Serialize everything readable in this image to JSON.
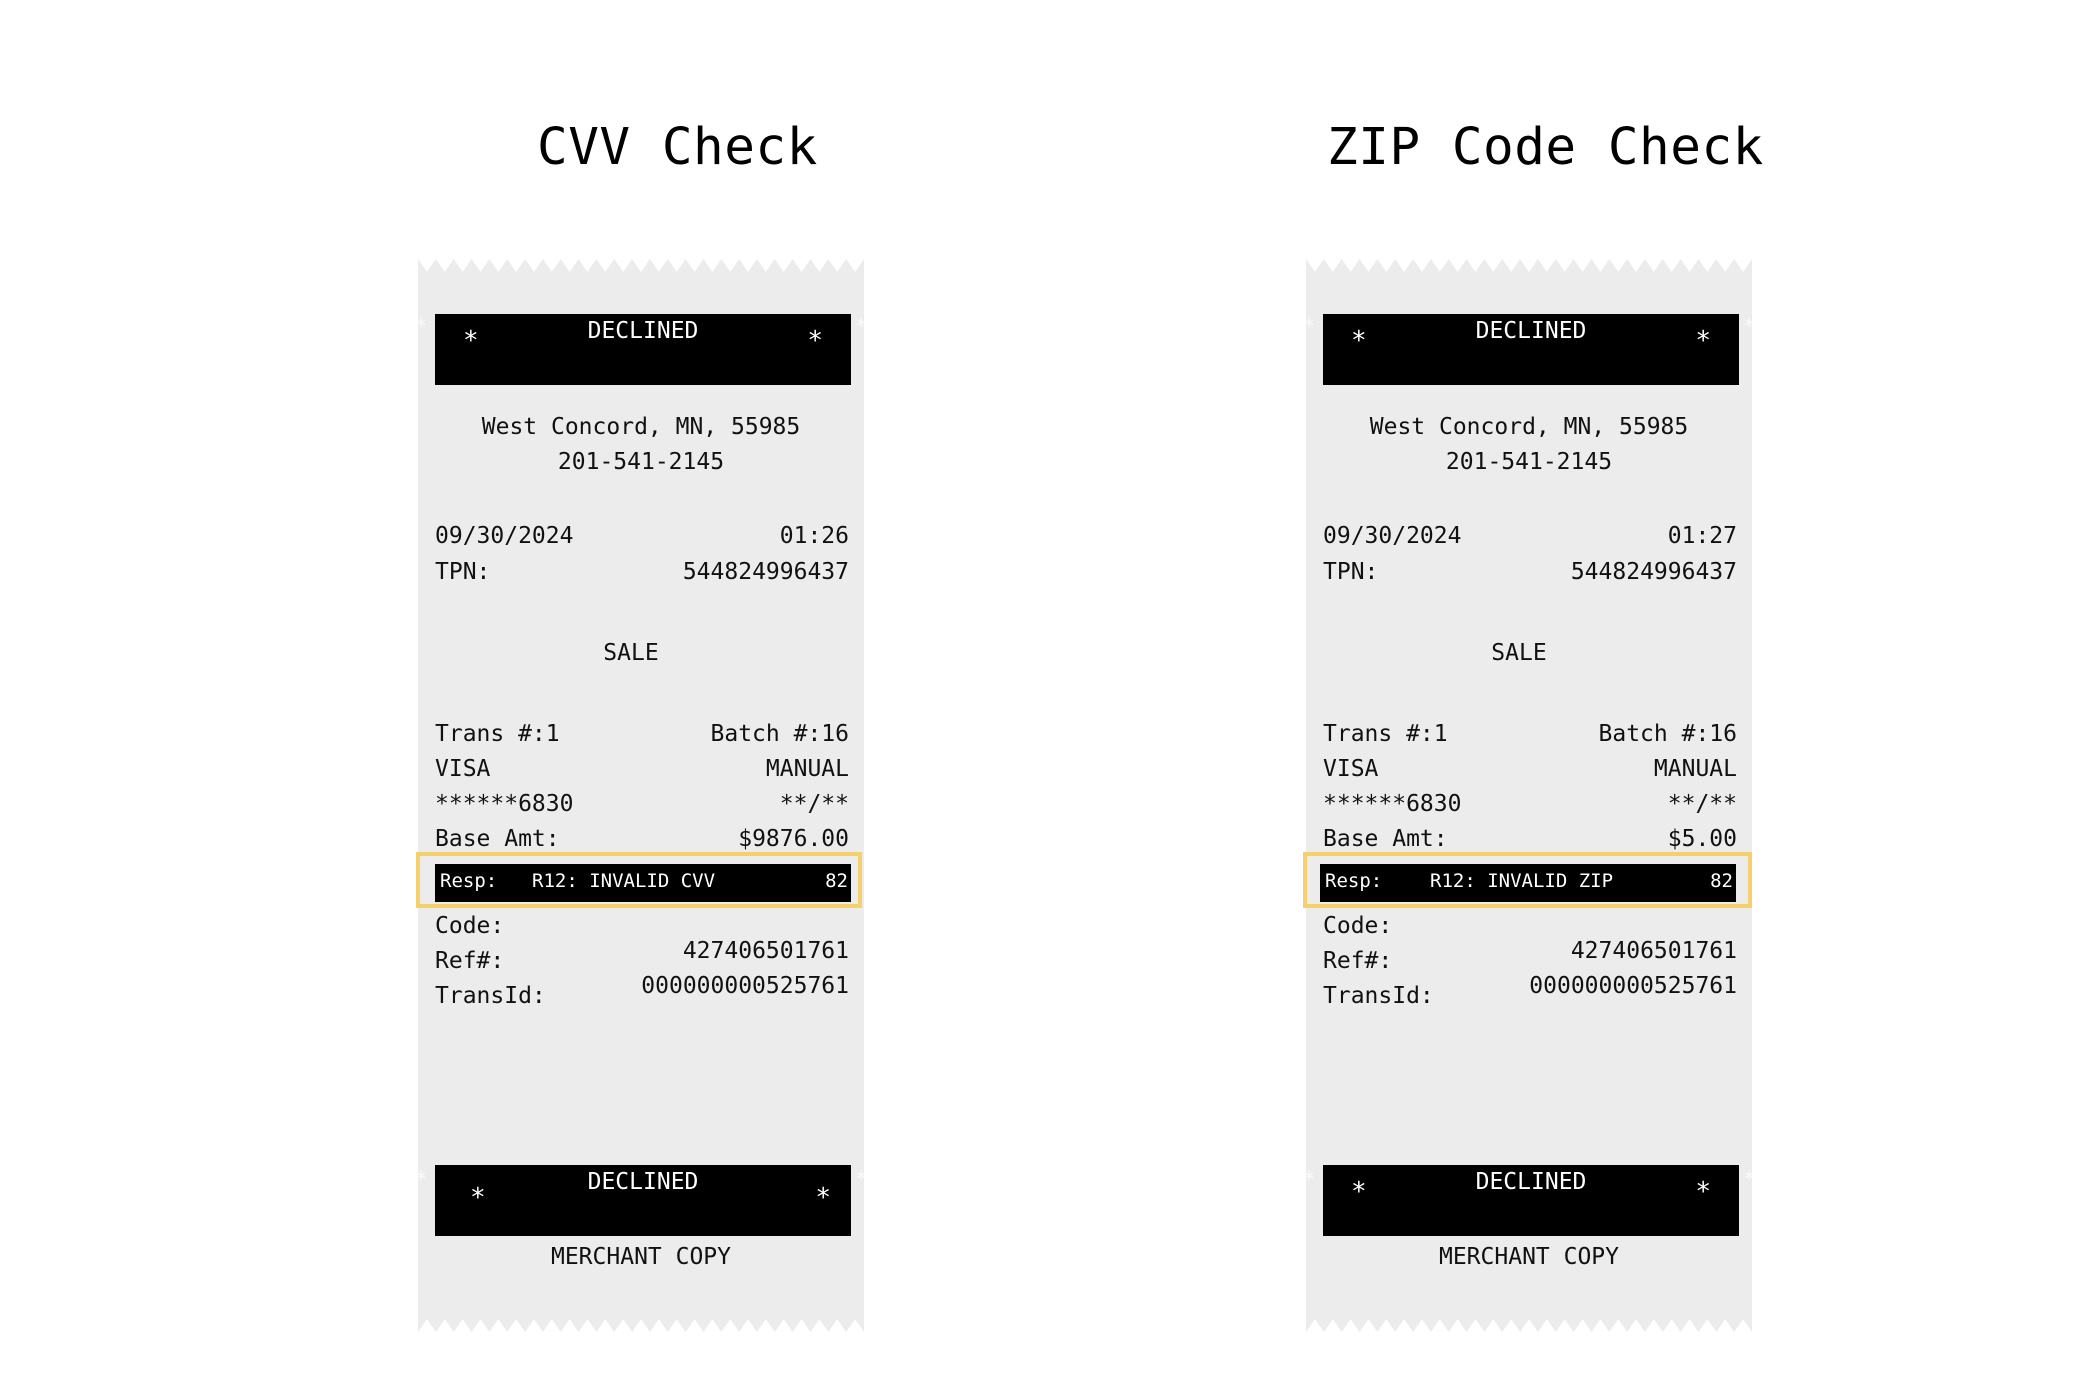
{
  "panels": [
    {
      "title": "CVV Check",
      "receipt": {
        "header_banner": "DECLINED",
        "banner_star": "*",
        "address": "West Concord, MN, 55985",
        "phone": "201-541-2145",
        "date": "09/30/2024",
        "time": "01:26",
        "tpn_label": "TPN:",
        "tpn_value": "544824996437",
        "transaction_type": "SALE",
        "trans_label": "Trans #:1",
        "batch_label": "Batch #:16",
        "card_brand": "VISA",
        "entry_mode": "MANUAL",
        "card_number": "******6830",
        "expiry": "**/**",
        "base_amt_label": "Base Amt:",
        "base_amt_value": "$9876.00",
        "resp_label": "Resp:",
        "resp_message": "R12: INVALID CVV",
        "resp_code": "82",
        "code_label": "Code:",
        "ref_label": "Ref#:",
        "ref_value": "427406501761",
        "transid_label": "TransId:",
        "transid_value": "000000000525761",
        "footer_banner": "DECLINED",
        "copy_label": "MERCHANT COPY"
      }
    },
    {
      "title": "ZIP Code Check",
      "receipt": {
        "header_banner": "DECLINED",
        "banner_star": "*",
        "address": "West Concord, MN, 55985",
        "phone": "201-541-2145",
        "date": "09/30/2024",
        "time": "01:27",
        "tpn_label": "TPN:",
        "tpn_value": "544824996437",
        "transaction_type": "SALE",
        "trans_label": "Trans #:1",
        "batch_label": "Batch #:16",
        "card_brand": "VISA",
        "entry_mode": "MANUAL",
        "card_number": "******6830",
        "expiry": "**/**",
        "base_amt_label": "Base Amt:",
        "base_amt_value": "$5.00",
        "resp_label": "Resp:",
        "resp_message": "R12: INVALID ZIP",
        "resp_code": "82",
        "code_label": "Code:",
        "ref_label": "Ref#:",
        "ref_value": "427406501761",
        "transid_label": "TransId:",
        "transid_value": "000000000525761",
        "footer_banner": "DECLINED",
        "copy_label": "MERCHANT COPY"
      }
    }
  ],
  "colors": {
    "paper": "#ececec",
    "highlight": "#f5d06b",
    "banner": "#000000"
  }
}
